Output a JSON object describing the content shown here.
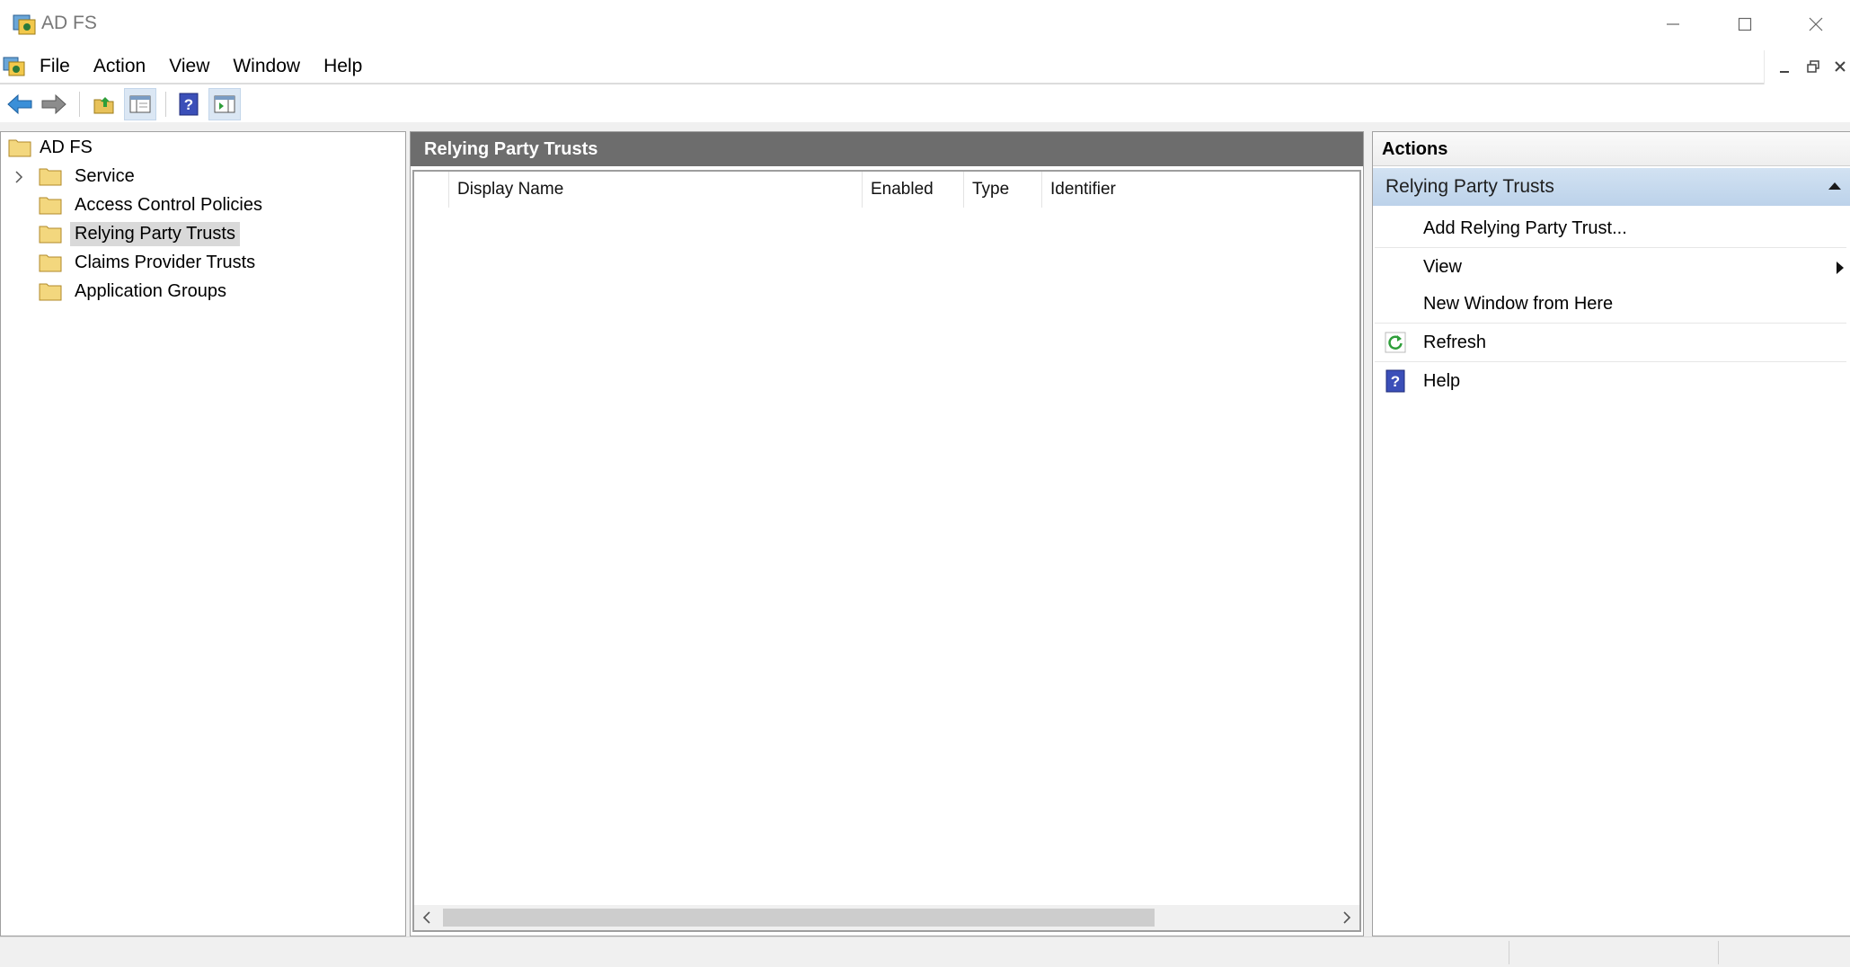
{
  "window": {
    "title": "AD FS",
    "app_icon": "adfs-snapin-icon",
    "controls": [
      "minimize-icon",
      "maximize-icon",
      "close-icon"
    ]
  },
  "menu": {
    "items": [
      "File",
      "Action",
      "View",
      "Window",
      "Help"
    ],
    "mdi_controls": [
      "mdi-minimize-icon",
      "mdi-restore-icon",
      "mdi-close-icon"
    ]
  },
  "toolbar": {
    "buttons": [
      "back-arrow-icon",
      "forward-arrow-icon",
      "up-folder-icon",
      "show-hide-tree-icon",
      "help-icon",
      "show-hide-action-pane-icon"
    ]
  },
  "tree": {
    "root": "AD FS",
    "items": [
      {
        "label": "Service",
        "expandable": true
      },
      {
        "label": "Access Control Policies",
        "expandable": false
      },
      {
        "label": "Relying Party Trusts",
        "expandable": false,
        "selected": true
      },
      {
        "label": "Claims Provider Trusts",
        "expandable": false
      },
      {
        "label": "Application Groups",
        "expandable": false
      }
    ]
  },
  "center": {
    "title": "Relying Party Trusts",
    "columns": [
      "Display Name",
      "Enabled",
      "Type",
      "Identifier"
    ],
    "rows": []
  },
  "actions": {
    "title": "Actions",
    "section": "Relying Party Trusts",
    "items": [
      {
        "label": "Add Relying Party Trust...",
        "icon": ""
      },
      {
        "label": "View",
        "icon": "",
        "submenu": true
      },
      {
        "label": "New Window from Here",
        "icon": ""
      },
      {
        "label": "Refresh",
        "icon": "refresh-icon"
      },
      {
        "label": "Help",
        "icon": "help-icon"
      }
    ]
  },
  "colors": {
    "header_gray": "#6d6d6d",
    "action_section_blue": "#c8dbef",
    "selection": "#d9d9d9"
  }
}
